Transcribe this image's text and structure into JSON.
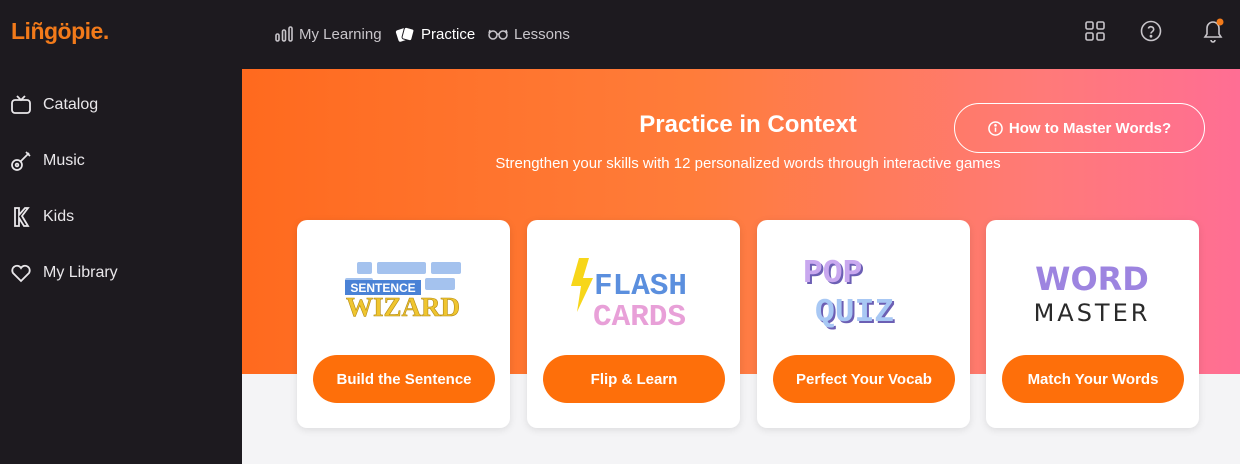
{
  "app": {
    "logo": "Liñgöpie."
  },
  "sidebar": {
    "items": [
      {
        "label": "Catalog",
        "icon": "tv-icon"
      },
      {
        "label": "Music",
        "icon": "guitar-icon"
      },
      {
        "label": "Kids",
        "icon": "kids-icon"
      },
      {
        "label": "My Library",
        "icon": "heart-icon"
      }
    ]
  },
  "topnav": {
    "items": [
      {
        "label": "My Learning",
        "icon": "bar-chart-icon"
      },
      {
        "label": "Practice",
        "icon": "cards-icon"
      },
      {
        "label": "Lessons",
        "icon": "glasses-icon"
      }
    ],
    "active": "Practice",
    "icons": [
      "apps-grid-icon",
      "help-icon",
      "bell-icon"
    ]
  },
  "hero": {
    "title": "Practice in Context",
    "subtitle": "Strengthen your skills with 12 personalized words through interactive games",
    "howto_label": "How to Master Words?"
  },
  "cards": [
    {
      "logo_line1": "SENTENCE",
      "logo_line2": "WIZARD",
      "button": "Build the Sentence"
    },
    {
      "logo_line1": "FLASH",
      "logo_line2": "CARDS",
      "button": "Flip & Learn"
    },
    {
      "logo_line1": "POP",
      "logo_line2": "QUIZ",
      "button": "Perfect Your Vocab"
    },
    {
      "logo_line1": "WORD",
      "logo_line2": "MASTER",
      "button": "Match Your Words"
    }
  ],
  "colors": {
    "accent": "#fe6f0a",
    "sidebar_bg": "#1d1a1f",
    "notification_dot": "#f27a1a"
  }
}
